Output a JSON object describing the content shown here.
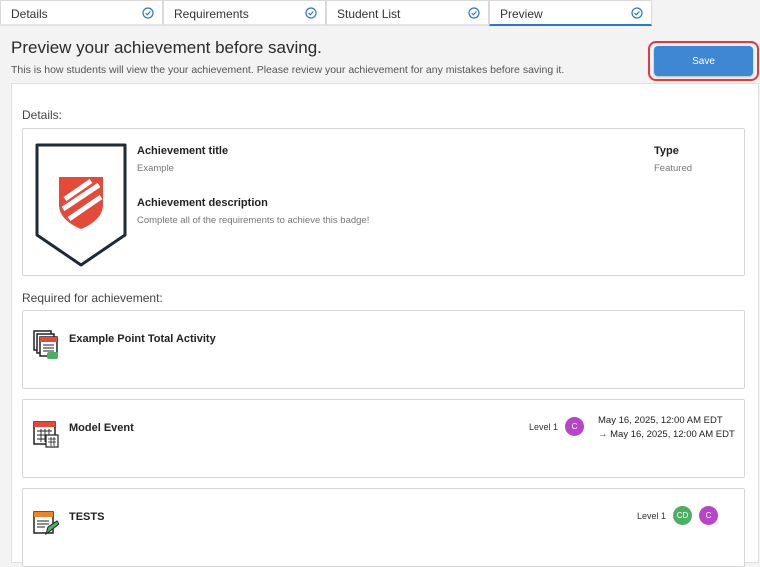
{
  "tabs": [
    {
      "label": "Details"
    },
    {
      "label": "Requirements"
    },
    {
      "label": "Student List"
    },
    {
      "label": "Preview"
    }
  ],
  "header": {
    "title": "Preview your achievement before saving.",
    "subtitle": "This is how students will view the your achievement. Please review your achievement for any mistakes before saving it.",
    "save_label": "Save"
  },
  "details": {
    "section_label": "Details:",
    "title_label": "Achievement title",
    "title_value": "Example",
    "description_label": "Achievement description",
    "description_value": "Complete all of the requirements to achieve this badge!",
    "type_label": "Type",
    "type_value": "Featured"
  },
  "requirements": {
    "section_label": "Required for achievement:",
    "items": [
      {
        "name": "Example Point Total Activity"
      },
      {
        "name": "Model Event",
        "level": "Level 1",
        "avatars": [
          "C"
        ],
        "date_start": "May 16, 2025, 12:00 AM EDT",
        "date_end": "May 16, 2025, 12:00 AM EDT"
      },
      {
        "name": "TESTS",
        "level": "Level 1",
        "avatars": [
          "CD",
          "C"
        ]
      }
    ]
  },
  "colors": {
    "accent": "#3f86d3",
    "tab_active": "#2f78c4",
    "highlight": "#e03a3a",
    "badge_red": "#e34a3a",
    "avatar_purple": "#b645c8",
    "avatar_green": "#4caf63"
  }
}
